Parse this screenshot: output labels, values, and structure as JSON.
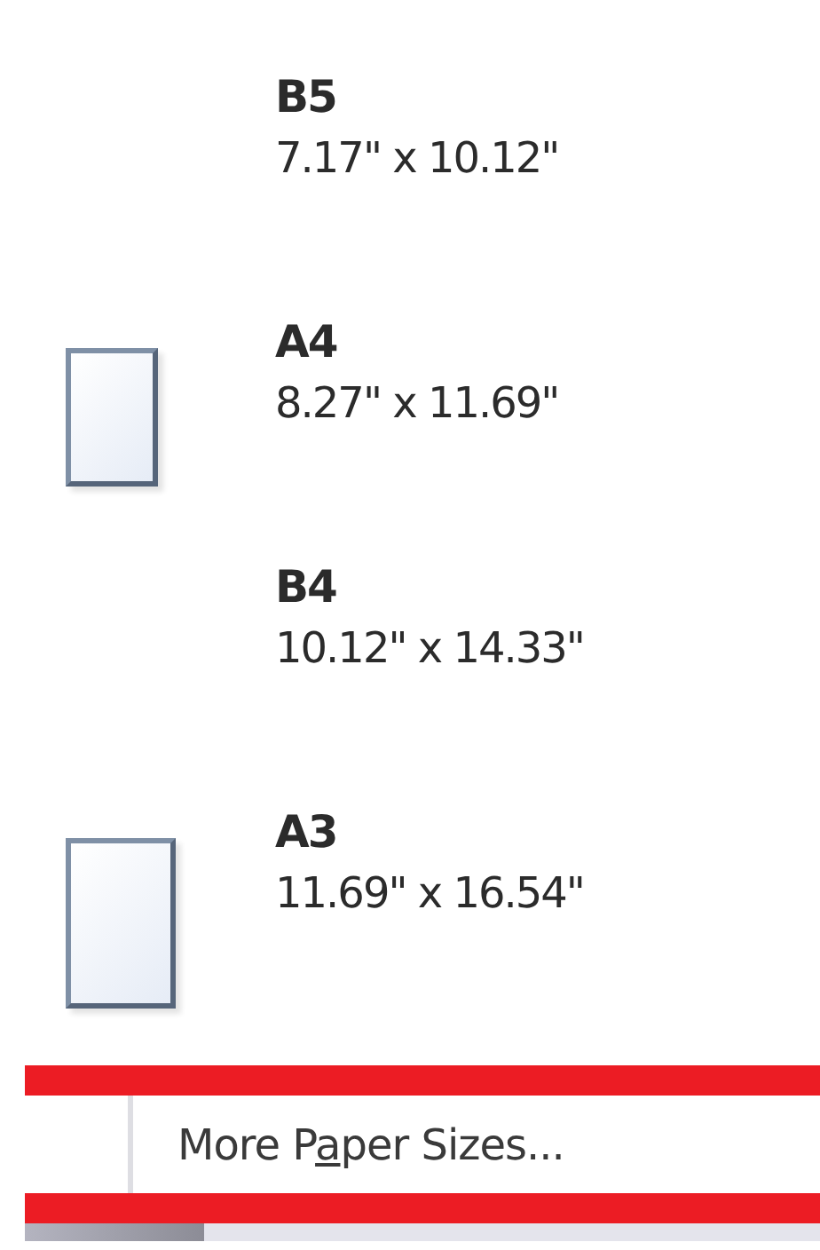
{
  "paper_sizes": [
    {
      "name": "B5",
      "dimensions": "7.17\" x 10.12\"",
      "kind": "none"
    },
    {
      "name": "A4",
      "dimensions": "8.27\" x 11.69\"",
      "kind": "page-small"
    },
    {
      "name": "B4",
      "dimensions": "10.12\" x 14.33\"",
      "kind": "none"
    },
    {
      "name": "A3",
      "dimensions": "11.69\" x 16.54\"",
      "kind": "page-large"
    }
  ],
  "more_item": {
    "label_before": "More P",
    "access_key": "a",
    "label_after": "per Sizes...",
    "highlighted": true
  }
}
